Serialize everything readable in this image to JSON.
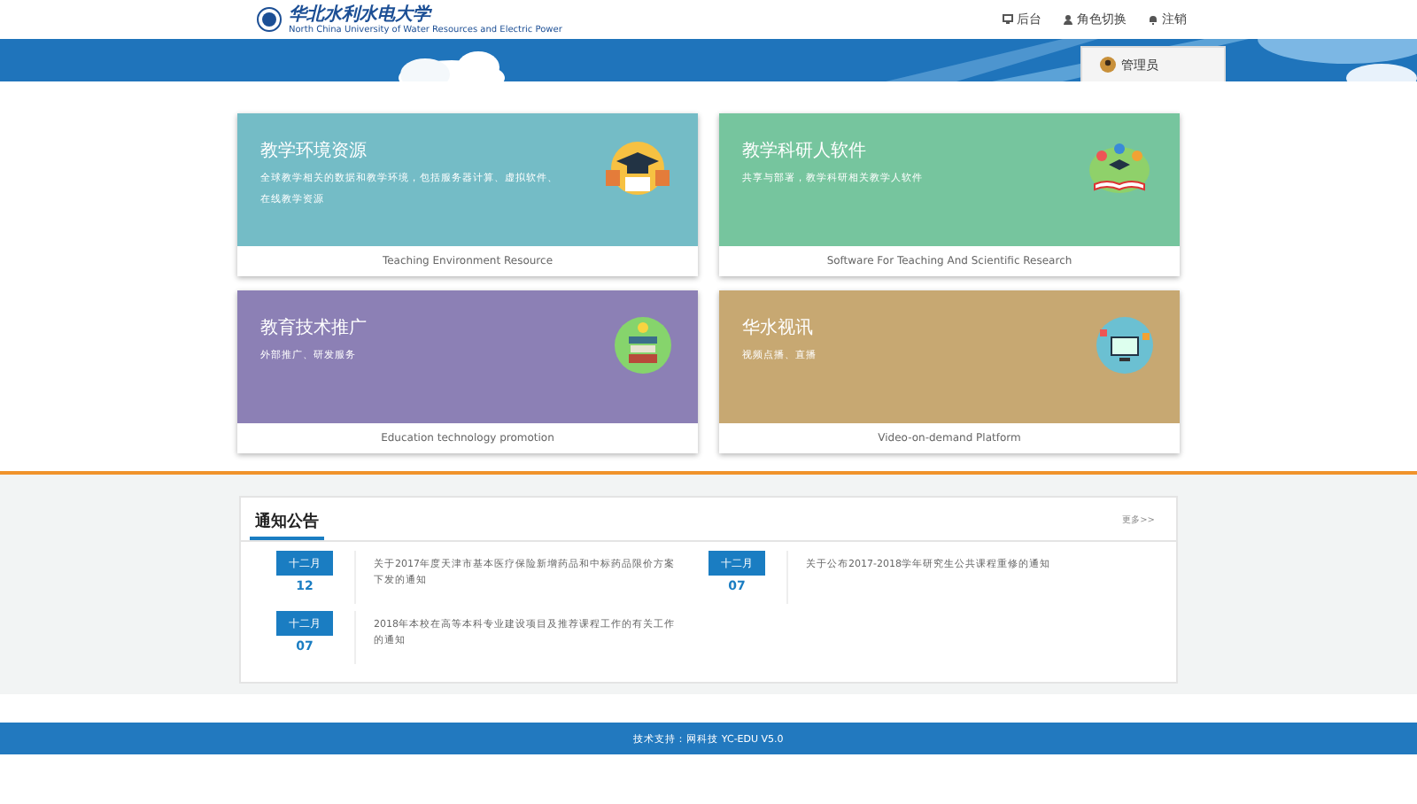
{
  "header": {
    "logo_text": "华北水利水电大学",
    "logo_subtitle": "North China University of Water Resources and Electric Power",
    "nav": [
      {
        "label": "后台",
        "kind": "monitor"
      },
      {
        "label": "角色切换",
        "kind": "user"
      },
      {
        "label": "注销",
        "kind": "bell"
      }
    ],
    "user_button": "管理员"
  },
  "cards": [
    {
      "title": "教学环境资源",
      "description": "全球教学相关的数据和教学环境，包括服务器计算、虚拟软件、",
      "description_2": "在线教学资源",
      "footer": "Teaching Environment Resource",
      "color": "#74bcc6",
      "kind": "cap"
    },
    {
      "title": "教学科研人软件",
      "description": "共享与部署，教学科研相关教学人软件",
      "footer": "Software For Teaching And Scientific Research",
      "color": "#76c59e",
      "kind": "book"
    },
    {
      "title": "教育技术推广",
      "description": "外部推广、研发服务",
      "footer": "Education technology promotion",
      "color": "#8c80b5",
      "kind": "books"
    },
    {
      "title": "华水视讯",
      "description": "视频点播、直播",
      "footer": "Video-on-demand Platform",
      "color": "#c7a872",
      "kind": "screen"
    }
  ],
  "notices": {
    "title": "通知公告",
    "more": "更多>>",
    "items": [
      {
        "month": "十二月",
        "day": "12",
        "text": "关于2017年度天津市基本医疗保险新增药品和中标药品限价方案下发的通知"
      },
      {
        "month": "十二月",
        "day": "07",
        "text": "关于公布2017-2018学年研究生公共课程重修的通知"
      },
      {
        "month": "十二月",
        "day": "07",
        "text": "2018年本校在高等本科专业建设项目及推荐课程工作的有关工作的通知"
      }
    ]
  },
  "footer": "技术支持：网科技 YC-EDU V5.0"
}
